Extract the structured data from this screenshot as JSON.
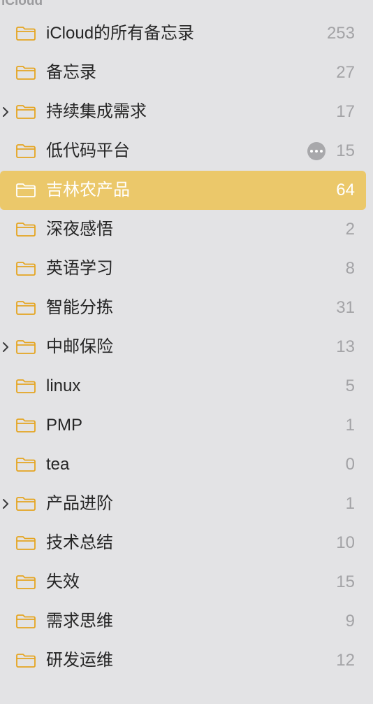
{
  "section": {
    "title": "iCloud"
  },
  "colors": {
    "accent": "#ebc86a",
    "folder_icon": "#e5a521",
    "background": "#e3e3e5"
  },
  "folders": [
    {
      "label": "iCloud的所有备忘录",
      "count": "253",
      "icon": "folder-icon"
    },
    {
      "label": "备忘录",
      "count": "27",
      "icon": "folder-icon"
    },
    {
      "label": "持续集成需求",
      "count": "17",
      "icon": "folder-icon",
      "expandable": true
    },
    {
      "label": "低代码平台",
      "count": "15",
      "icon": "folder-icon",
      "shared": true
    },
    {
      "label": "吉林农产品",
      "count": "64",
      "icon": "folder-icon",
      "selected": true
    },
    {
      "label": "深夜感悟",
      "count": "2",
      "icon": "folder-icon"
    },
    {
      "label": "英语学习",
      "count": "8",
      "icon": "folder-icon"
    },
    {
      "label": "智能分拣",
      "count": "31",
      "icon": "folder-icon"
    },
    {
      "label": "中邮保险",
      "count": "13",
      "icon": "folder-icon",
      "expandable": true
    },
    {
      "label": "linux",
      "count": "5",
      "icon": "folder-icon"
    },
    {
      "label": "PMP",
      "count": "1",
      "icon": "folder-icon"
    },
    {
      "label": "tea",
      "count": "0",
      "icon": "folder-icon"
    },
    {
      "label": "产品进阶",
      "count": "1",
      "icon": "folder-icon",
      "expandable": true
    },
    {
      "label": "技术总结",
      "count": "10",
      "icon": "folder-icon"
    },
    {
      "label": "失效",
      "count": "15",
      "icon": "folder-icon"
    },
    {
      "label": "需求思维",
      "count": "9",
      "icon": "folder-icon"
    },
    {
      "label": "研发运维",
      "count": "12",
      "icon": "folder-icon"
    }
  ]
}
